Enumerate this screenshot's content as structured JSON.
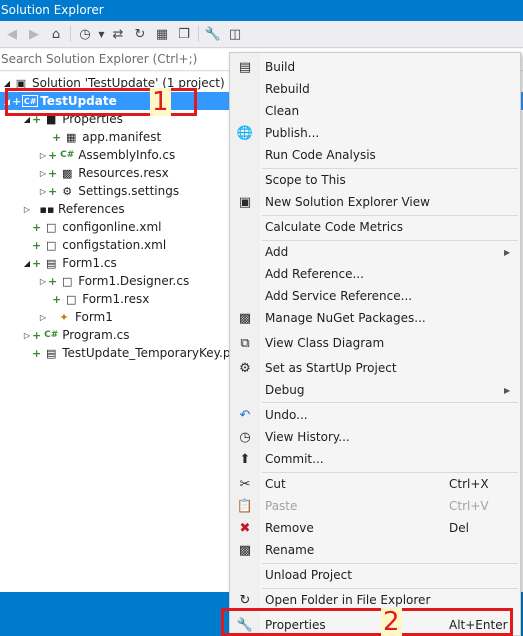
{
  "window": {
    "title": "Solution Explorer"
  },
  "toolbar": {
    "icons": [
      "back-icon",
      "forward-icon",
      "home-icon",
      "history-icon",
      "dropdown-icon",
      "sync-icon",
      "refresh-icon",
      "collapse-all-icon",
      "show-all-files-icon",
      "properties-icon",
      "preview-icon"
    ]
  },
  "search": {
    "placeholder": "Search Solution Explorer (Ctrl+;)"
  },
  "tree": {
    "solution": "Solution 'TestUpdate' (1 project)",
    "project": "TestUpdate",
    "project_badge": "C#",
    "properties": "Properties",
    "app_manifest": "app.manifest",
    "assembly_info": "AssemblyInfo.cs",
    "resources": "Resources.resx",
    "settings": "Settings.settings",
    "references": "References",
    "configonline": "configonline.xml",
    "configstation": "configstation.xml",
    "form1": "Form1.cs",
    "form1_designer": "Form1.Designer.cs",
    "form1_resx": "Form1.resx",
    "form1_class": "Form1",
    "program": "Program.cs",
    "temp_key": "TestUpdate_TemporaryKey.pfx"
  },
  "context_menu": {
    "build": "Build",
    "rebuild": "Rebuild",
    "clean": "Clean",
    "publish": "Publish...",
    "run_code_analysis": "Run Code Analysis",
    "scope_to_this": "Scope to This",
    "new_solution_explorer_view": "New Solution Explorer View",
    "calculate_code_metrics": "Calculate Code Metrics",
    "add": "Add",
    "add_reference": "Add Reference...",
    "add_service_reference": "Add Service Reference...",
    "manage_nuget": "Manage NuGet Packages...",
    "view_class_diagram": "View Class Diagram",
    "set_startup": "Set as StartUp Project",
    "debug": "Debug",
    "undo": "Undo...",
    "view_history": "View History...",
    "commit": "Commit...",
    "cut": "Cut",
    "cut_key": "Ctrl+X",
    "paste": "Paste",
    "paste_key": "Ctrl+V",
    "remove": "Remove",
    "remove_key": "Del",
    "rename": "Rename",
    "unload_project": "Unload Project",
    "open_folder": "Open Folder in File Explorer",
    "properties": "Properties",
    "properties_key": "Alt+Enter"
  },
  "annotations": {
    "callout_1": "1",
    "callout_2": "2",
    "color": "#e0191f"
  },
  "colors": {
    "accent": "#007acc",
    "selection": "#3399ff",
    "added_marker": "#388a34"
  }
}
